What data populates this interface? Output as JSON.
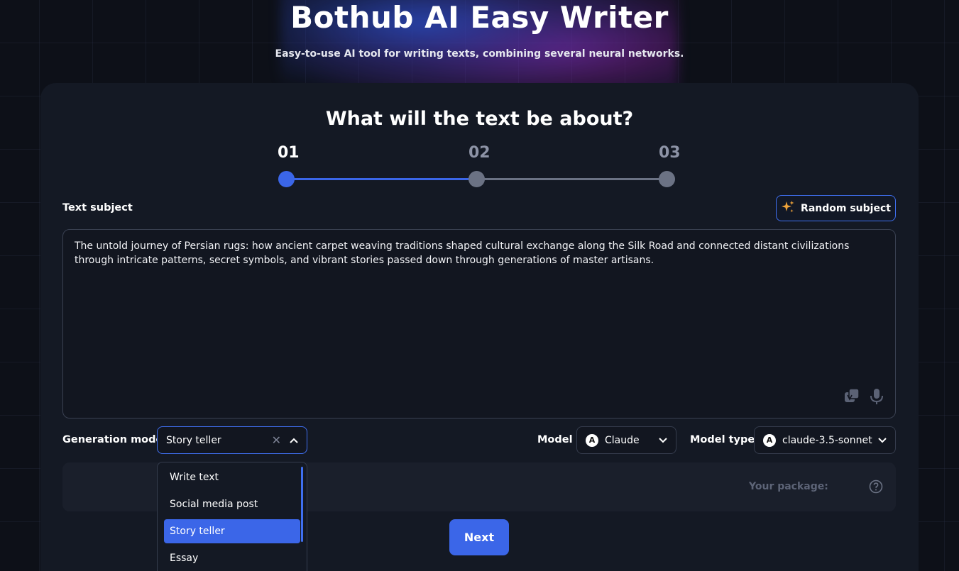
{
  "header": {
    "title": "Bothub AI Easy Writer",
    "subtitle": "Easy-to-use AI tool for writing texts, combining several neural networks."
  },
  "form": {
    "question": "What will the text be about?",
    "steps": [
      {
        "label": "01",
        "state": "active"
      },
      {
        "label": "02",
        "state": "inactive"
      },
      {
        "label": "03",
        "state": "inactive"
      }
    ],
    "text_subject_label": "Text subject",
    "random_subject_label": "Random subject",
    "subject_value": "The untold journey of Persian rugs: how ancient carpet weaving traditions shaped cultural exchange along the Silk Road and connected distant civilizations through intricate patterns, secret symbols, and vibrant stories passed down through generations of master artisans.",
    "generation_mode_label": "Generation mode",
    "generation_mode_value": "Story teller",
    "generation_mode_options": [
      "Write text",
      "Social media post",
      "Story teller",
      "Essay"
    ],
    "model_label": "Model",
    "model_value": "Claude",
    "model_type_label": "Model type",
    "model_type_value": "claude-3.5-sonnet",
    "package_label": "Your package:",
    "next_label": "Next"
  },
  "colors": {
    "accent": "#3b66e8",
    "inactive_step": "#6b7284",
    "background": "#0d1018",
    "card": "#141924"
  }
}
